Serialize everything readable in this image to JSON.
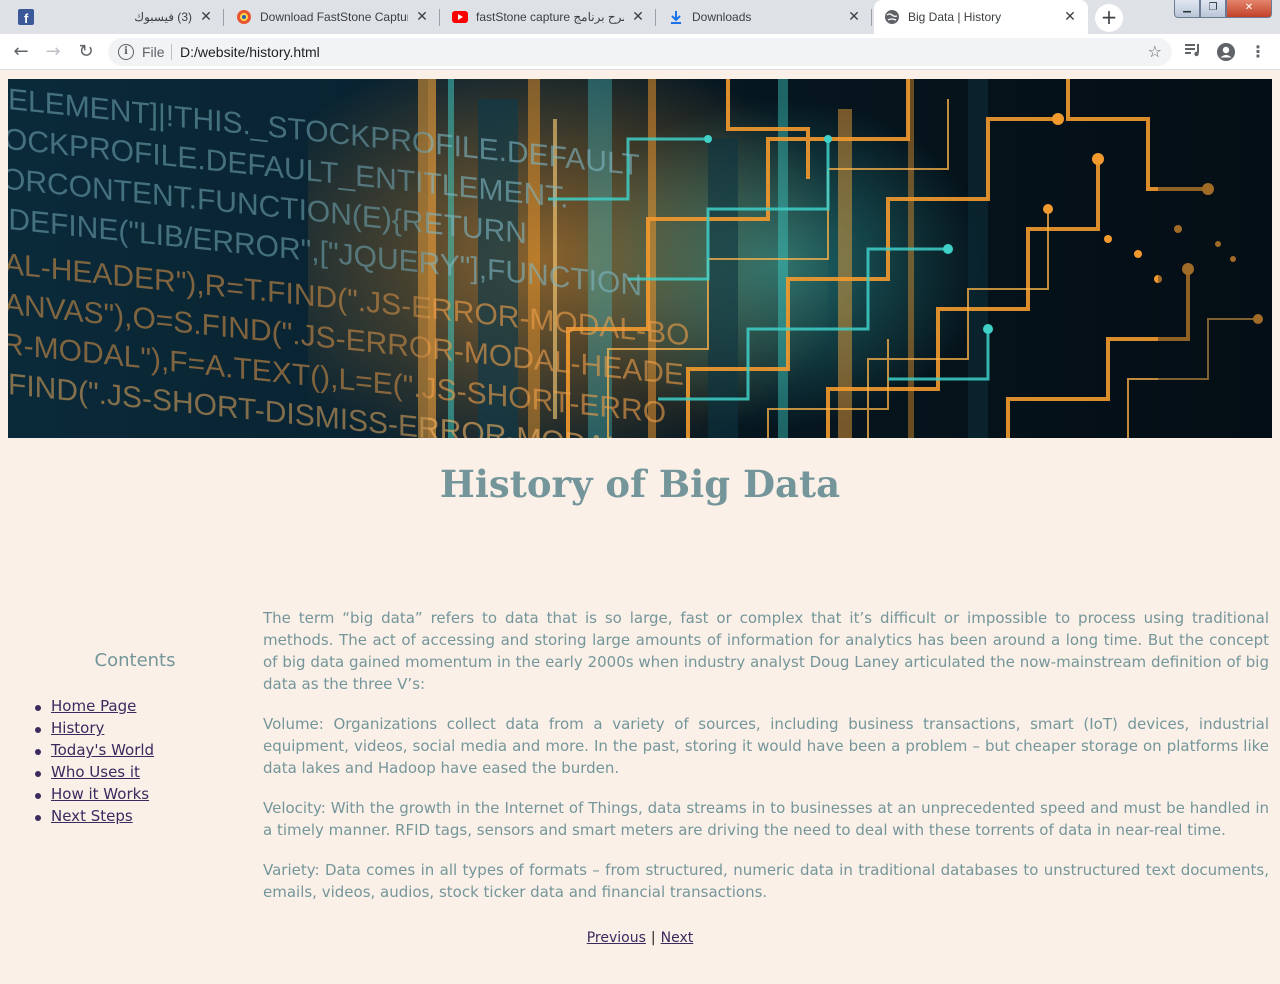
{
  "browser": {
    "tabs": [
      {
        "title": "(3) فيسبوك",
        "favicon": "facebook-icon",
        "active": false
      },
      {
        "title": "Download FastStone Capture",
        "favicon": "faststone-icon",
        "active": false
      },
      {
        "title": "fastStone capture شرح برنامج",
        "favicon": "youtube-icon",
        "active": false
      },
      {
        "title": "Downloads",
        "favicon": "download-icon",
        "active": false
      },
      {
        "title": "Big Data | History",
        "favicon": "globe-icon",
        "active": true
      }
    ],
    "new_tab_label": "+",
    "address": {
      "scheme": "File",
      "url": "D:/website/history.html"
    }
  },
  "page": {
    "title": "History of Big Data",
    "sidebar": {
      "heading": "Contents",
      "items": [
        {
          "label": "Home Page"
        },
        {
          "label": "History"
        },
        {
          "label": "Today's World"
        },
        {
          "label": "Who Uses it"
        },
        {
          "label": "How it Works"
        },
        {
          "label": "Next Steps"
        }
      ]
    },
    "paragraphs": [
      "The term “big data” refers to data that is so large, fast or complex that it’s difficult or impossible to process using traditional methods. The act of accessing and storing large amounts of information for analytics has been around a long time. But the concept of big data gained momentum in the early 2000s when industry analyst Doug Laney articulated the now-mainstream definition of big data as the three V’s:",
      "Volume: Organizations collect data from a variety of sources, including business transactions, smart (IoT) devices, industrial equipment, videos, social media and more. In the past, storing it would have been a problem – but cheaper storage on platforms like data lakes and Hadoop have eased the burden.",
      "Velocity: With the growth in the Internet of Things, data streams in to businesses at an unprecedented speed and must be handled in a timely manner. RFID tags, sensors and smart meters are driving the need to deal with these torrents of data in near-real time.",
      "Variety: Data comes in all types of formats – from structured, numeric data in traditional databases to unstructured text documents, emails, videos, audios, stock ticker data and financial transactions."
    ],
    "pager": {
      "previous": "Previous",
      "separator": "|",
      "next": "Next"
    },
    "hero_code_lines": [
      "ELEMENT]|!THIS._STOCKPROFILE.DEFAULT",
      "OCKPROFILE.DEFAULT_ENTITLEMENT.",
      "ORCONTENT.FUNCTION(E){RETURN",
      ".DEFINE(\"LIB/ERROR\",[\"JQUERY\"],FUNCTION",
      "AL-HEADER\"),R=T.FIND(\".JS-ERROR-MODAL-BO",
      "ANVAS\"),O=S.FIND(\".JS-ERROR-MODAL-HEADE",
      "R-MODAL\"),F=A.TEXT(),L=E(\".JS-SHORT-ERRO",
      "FIND(\".JS-SHORT-DISMISS-ERROR-MODAL\")"
    ]
  },
  "colors": {
    "page_background": "#faf0e8",
    "title_color": "#74969a",
    "link_color": "#3a2a5e",
    "hero_orange": "#f39a2e",
    "hero_teal": "#3fd0c8"
  }
}
